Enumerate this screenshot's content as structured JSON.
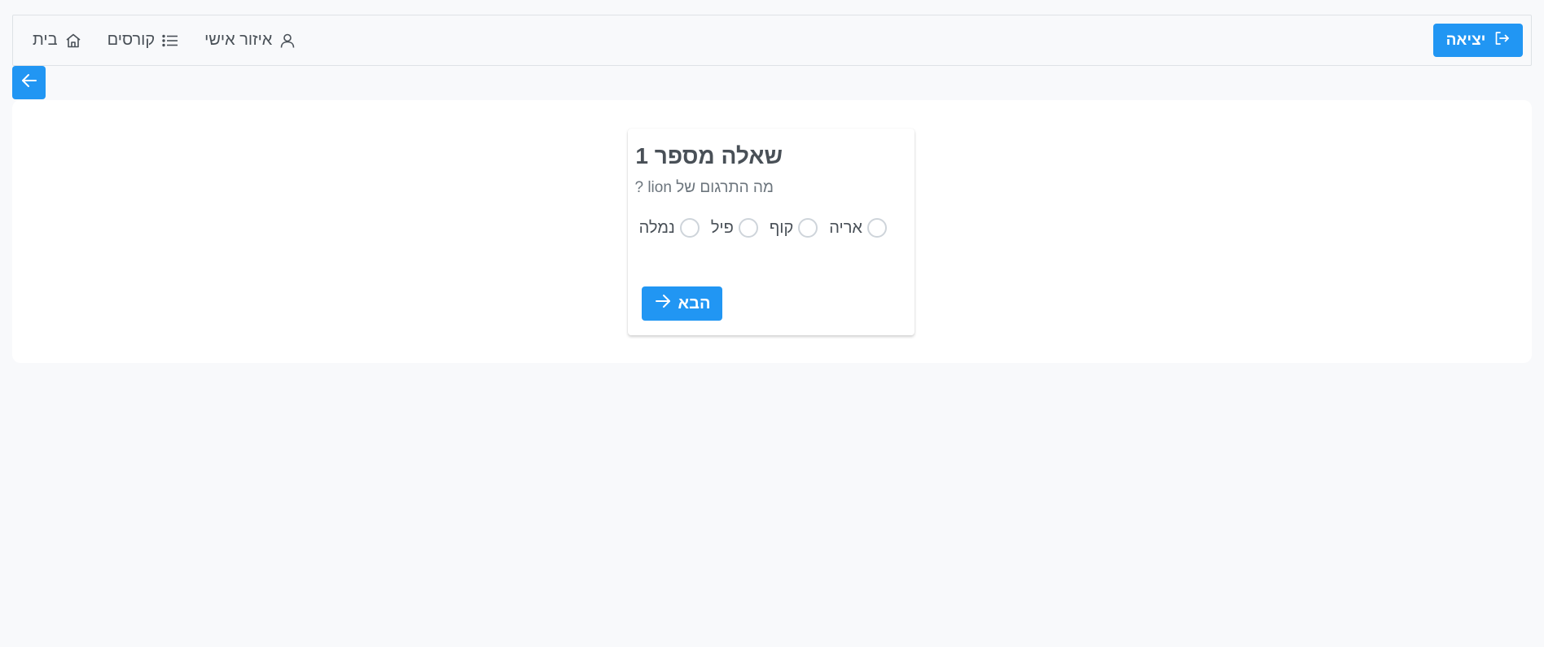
{
  "nav": {
    "home_label": "בית",
    "home_icon": "home-icon",
    "courses_label": "קורסים",
    "courses_icon": "list-icon",
    "profile_label": "איזור אישי",
    "profile_icon": "user-icon",
    "logout_label": "יציאה",
    "logout_icon": "sign-out-icon"
  },
  "back_button": {
    "icon": "arrow-left-icon"
  },
  "question": {
    "title": "שאלה מספר 1",
    "text": "מה התרגום של lion ?",
    "options": [
      {
        "label": "אריה",
        "selected": false
      },
      {
        "label": "קוף",
        "selected": false
      },
      {
        "label": "פיל",
        "selected": false
      },
      {
        "label": "נמלה",
        "selected": false
      }
    ],
    "next_label": "הבא",
    "next_icon": "arrow-right-icon"
  },
  "colors": {
    "primary": "#2196f3",
    "background": "#f8f9fb",
    "text": "#495057"
  }
}
